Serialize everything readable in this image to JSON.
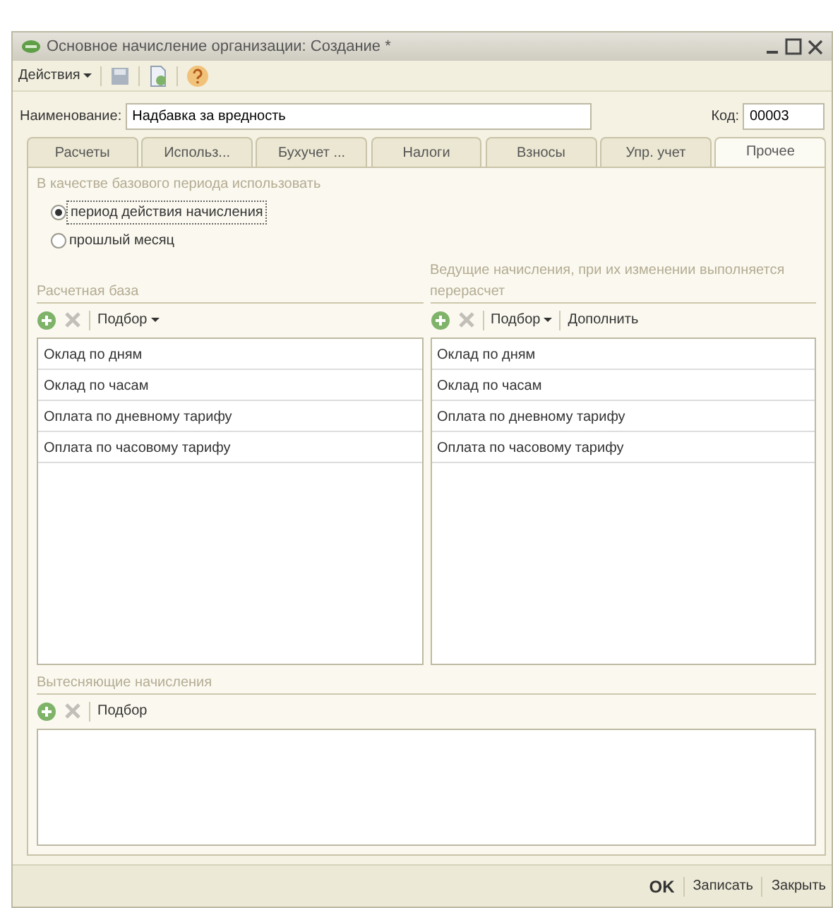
{
  "window": {
    "title": "Основное начисление организации: Создание *"
  },
  "toolbar": {
    "actions_menu": "Действия"
  },
  "name_field": {
    "label": "Наименование:",
    "value": "Надбавка за вредность"
  },
  "code_field": {
    "label": "Код:",
    "value": "00003"
  },
  "tabs": [
    {
      "label": "Расчеты",
      "selected": false
    },
    {
      "label": "Использ...",
      "selected": false
    },
    {
      "label": "Бухучет ...",
      "selected": false
    },
    {
      "label": "Налоги",
      "selected": false
    },
    {
      "label": "Взносы",
      "selected": false
    },
    {
      "label": "Упр. учет",
      "selected": false
    },
    {
      "label": "Прочее",
      "selected": true
    }
  ],
  "base_period": {
    "title": "В качестве базового периода использовать",
    "options": [
      {
        "label": "период действия начисления",
        "selected": true
      },
      {
        "label": "прошлый месяц",
        "selected": false
      }
    ]
  },
  "panels": [
    {
      "title": "Расчетная база",
      "toolbar": [
        {
          "kind": "add"
        },
        {
          "kind": "delete"
        },
        {
          "kind": "menu",
          "label": "Подбор"
        }
      ],
      "rows": [
        "Оклад по дням",
        "Оклад по часам",
        "Оплата по дневному тарифу",
        "Оплата по часовому тарифу"
      ]
    },
    {
      "title": "Ведущие начисления, при их изменении выполняется перерасчет",
      "toolbar": [
        {
          "kind": "add"
        },
        {
          "kind": "delete"
        },
        {
          "kind": "menu",
          "label": "Подбор"
        },
        {
          "kind": "button",
          "label": "Дополнить"
        }
      ],
      "rows": [
        "Оклад по дням",
        "Оклад по часам",
        "Оплата по дневному тарифу",
        "Оплата по часовому тарифу"
      ]
    }
  ],
  "displacing": {
    "title": "Вытесняющие начисления",
    "toolbar": [
      {
        "kind": "add"
      },
      {
        "kind": "delete"
      },
      {
        "kind": "button",
        "label": "Подбор"
      }
    ]
  },
  "footer_buttons": [
    {
      "label": "OK",
      "default": true
    },
    {
      "label": "Записать",
      "default": false
    },
    {
      "label": "Закрыть",
      "default": false
    }
  ]
}
